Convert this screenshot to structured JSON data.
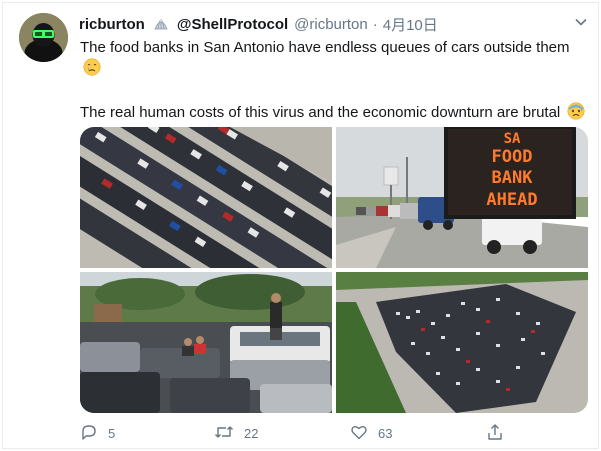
{
  "tweet": {
    "display_name": "ricburton",
    "secondary_name": "@ShellProtocol",
    "handle": "@ricburton",
    "separator": "·",
    "date": "4月10日",
    "line1": "The food banks in San Antonio have endless queues of cars outside them",
    "line2": "The real human costs of this virus and the economic downturn are brutal",
    "sign_text": [
      "SA",
      "FOOD",
      "BANK",
      "AHEAD"
    ]
  },
  "actions": {
    "replies": "5",
    "retweets": "22",
    "likes": "63"
  },
  "icons": {
    "emoji_1": "crying-face",
    "emoji_2": "anxious-face-with-sweat",
    "shell": "shell-icon",
    "caret": "chevron-down-icon",
    "reply": "reply-icon",
    "retweet": "retweet-icon",
    "like": "heart-icon",
    "share": "share-icon"
  },
  "colors": {
    "text_primary": "#14171a",
    "text_secondary": "#657786",
    "sign_led": "#ff7a2a",
    "border": "#e6ecf0"
  }
}
